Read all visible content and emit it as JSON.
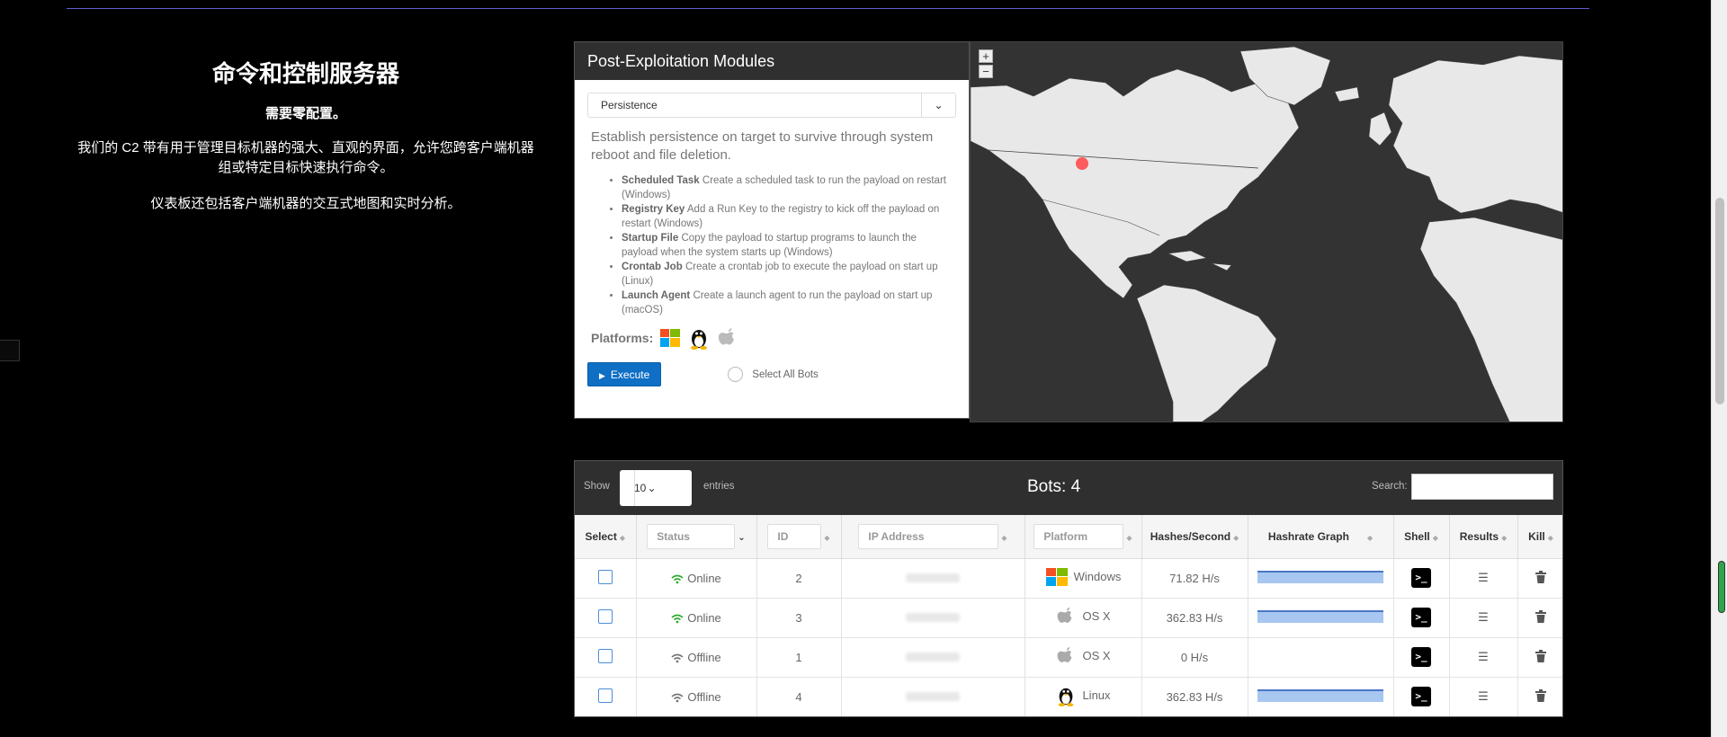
{
  "intro": {
    "title": "命令和控制服务器",
    "subtitle": "需要零配置。",
    "paragraph1": "我们的 C2 带有用于管理目标机器的强大、直观的界面，允许您跨客户端机器组或特定目标快速执行命令。",
    "paragraph2": "仪表板还包括客户端机器的交互式地图和实时分析。"
  },
  "modules": {
    "header": "Post-Exploitation Modules",
    "selected_module": "Persistence",
    "description": "Establish persistence on target to survive through system reboot and file deletion.",
    "items": [
      {
        "name": "Scheduled Task",
        "desc": "Create a scheduled task to run the payload on restart (Windows)"
      },
      {
        "name": "Registry Key",
        "desc": "Add a Run Key to the registry to kick off the payload on restart (Windows)"
      },
      {
        "name": "Startup File",
        "desc": "Copy the payload to startup programs to launch the payload when the system starts up (Windows)"
      },
      {
        "name": "Crontab Job",
        "desc": "Create a crontab job to execute the payload on start up (Linux)"
      },
      {
        "name": "Launch Agent",
        "desc": "Create a launch agent to run the payload on start up (macOS)"
      }
    ],
    "platforms_label": "Platforms:",
    "platforms": [
      "windows-icon",
      "linux-icon",
      "apple-icon"
    ],
    "execute_label": "Execute",
    "select_all_label": "Select All Bots"
  },
  "map": {
    "zoom_in": "+",
    "zoom_out": "−",
    "colors": {
      "land": "#e8e8e8",
      "water": "#333333",
      "marker": "#ff4d4d"
    }
  },
  "bots": {
    "show_label": "Show",
    "page_length": "10",
    "entries_label": "entries",
    "count_label": "Bots: 4",
    "search_label": "Search:",
    "search_value": "",
    "columns": {
      "select": "Select",
      "status": "Status",
      "id": "ID",
      "ip": "IP Address",
      "platform": "Platform",
      "hashes": "Hashes/Second",
      "graph": "Hashrate Graph",
      "shell": "Shell",
      "results": "Results",
      "kill": "Kill"
    },
    "rows": [
      {
        "status": "Online",
        "id": "2",
        "platform": "Windows",
        "hashes": "71.82 H/s",
        "graph": true
      },
      {
        "status": "Online",
        "id": "3",
        "platform": "OS X",
        "hashes": "362.83 H/s",
        "graph": true
      },
      {
        "status": "Offline",
        "id": "1",
        "platform": "OS X",
        "hashes": "0 H/s",
        "graph": false
      },
      {
        "status": "Offline",
        "id": "4",
        "platform": "Linux",
        "hashes": "362.83 H/s",
        "graph": true
      }
    ],
    "colors": {
      "online": "#2eaa2e",
      "offline": "#777777",
      "graph_fill": "#a7c6f0",
      "graph_line": "#4a76c8"
    }
  }
}
